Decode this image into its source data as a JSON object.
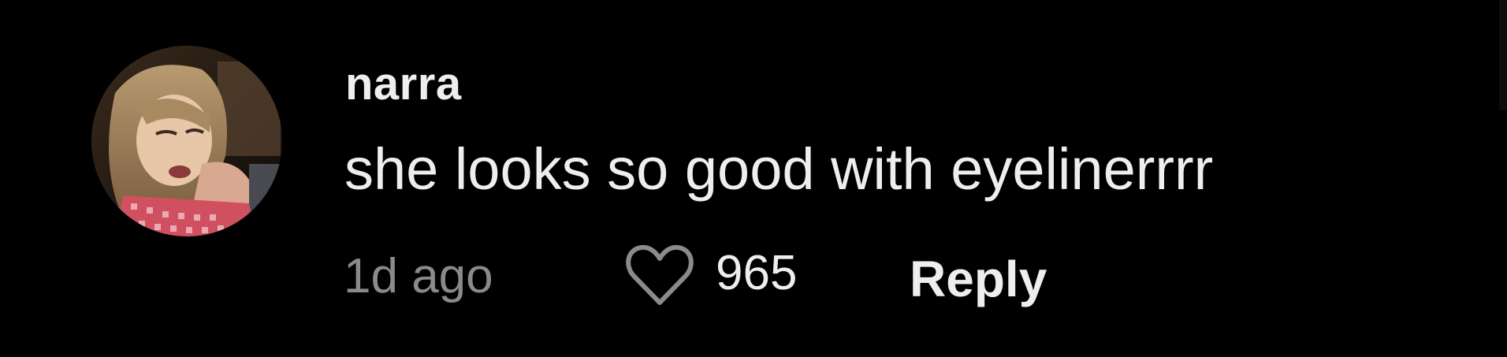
{
  "comment": {
    "username": "narra",
    "text": "she looks so good with eyelinerrrr",
    "time": "1d ago",
    "like_count": "965",
    "reply_label": "Reply",
    "avatar_icon": "user-avatar-photo",
    "like_icon": "heart-outline-icon"
  },
  "colors": {
    "background": "#000000",
    "primary_text": "#eeeeee",
    "secondary_text": "#8a8a8a"
  }
}
